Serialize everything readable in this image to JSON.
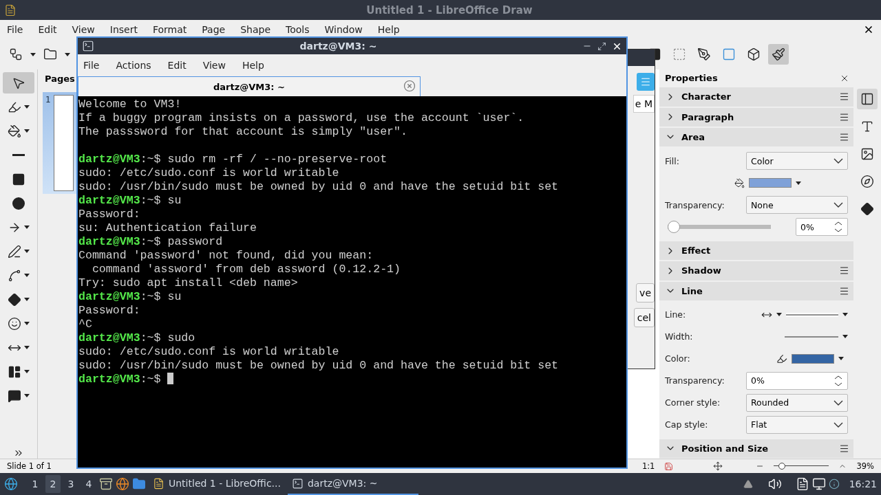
{
  "office": {
    "title": "Untitled 1 - LibreOffice Draw",
    "menu": [
      "File",
      "Edit",
      "View",
      "Insert",
      "Format",
      "Page",
      "Shape",
      "Tools",
      "Window",
      "Help"
    ],
    "pages_label": "Pages",
    "page_number": "1",
    "dialog": {
      "text": "e M",
      "buttons": [
        "ve",
        "cel"
      ]
    },
    "sidebar": {
      "title": "Properties",
      "sections": [
        {
          "title": "Character",
          "expanded": false,
          "menu": true
        },
        {
          "title": "Paragraph",
          "expanded": false,
          "menu": true
        },
        {
          "title": "Area",
          "expanded": true,
          "menu": true,
          "fields": [
            {
              "kind": "select",
              "label": "Fill:",
              "value": "Color"
            },
            {
              "kind": "color",
              "color": "#7fa1d8"
            },
            {
              "kind": "select",
              "label": "Transparency:",
              "value": "None"
            },
            {
              "kind": "slider",
              "level": 0,
              "value": "0%"
            }
          ]
        },
        {
          "title": "Effect",
          "expanded": false,
          "menu": false
        },
        {
          "title": "Shadow",
          "expanded": false,
          "menu": true
        },
        {
          "title": "Line",
          "expanded": true,
          "menu": true,
          "fields": [
            {
              "kind": "line",
              "label": "Line:"
            },
            {
              "kind": "width",
              "label": "Width:"
            },
            {
              "kind": "color",
              "label": "Color:",
              "color": "#3465a4"
            },
            {
              "kind": "spin",
              "label": "Transparency:",
              "value": "0%"
            },
            {
              "kind": "select",
              "label": "Corner style:",
              "value": "Rounded"
            },
            {
              "kind": "select",
              "label": "Cap style:",
              "value": "Flat"
            }
          ]
        },
        {
          "title": "Position and Size",
          "expanded": true,
          "menu": true
        }
      ]
    },
    "status": {
      "slide": "Slide 1 of 1",
      "scale": "1:1",
      "zoom_slider": {
        "level": 0.14
      },
      "zoom": "39%"
    }
  },
  "terminal": {
    "title": "dartz@VM3: ~",
    "menu": [
      "File",
      "Actions",
      "Edit",
      "View",
      "Help"
    ],
    "tab": "dartz@VM3: ~",
    "lines": [
      {
        "kind": "output",
        "text": "Welcome to VM3!"
      },
      {
        "kind": "output",
        "text": "If a buggy program insists on a password, use the account `user`."
      },
      {
        "kind": "output",
        "text": "The passsword for that account is simply \"user\"."
      },
      {
        "kind": "blank"
      },
      {
        "kind": "prompt",
        "user": "dartz@VM3",
        "path": ":~$",
        "command": "sudo rm -rf / --no-preserve-root"
      },
      {
        "kind": "output",
        "text": "sudo: /etc/sudo.conf is world writable"
      },
      {
        "kind": "output",
        "text": "sudo: /usr/bin/sudo must be owned by uid 0 and have the setuid bit set"
      },
      {
        "kind": "prompt",
        "user": "dartz@VM3",
        "path": ":~$",
        "command": "su"
      },
      {
        "kind": "output",
        "text": "Password:"
      },
      {
        "kind": "output",
        "text": "su: Authentication failure"
      },
      {
        "kind": "prompt",
        "user": "dartz@VM3",
        "path": ":~$",
        "command": "password"
      },
      {
        "kind": "output",
        "text": "Command 'password' not found, did you mean:"
      },
      {
        "kind": "output",
        "text": "  command 'assword' from deb assword (0.12.2-1)"
      },
      {
        "kind": "output",
        "text": "Try: sudo apt install <deb name>"
      },
      {
        "kind": "prompt",
        "user": "dartz@VM3",
        "path": ":~$",
        "command": "su"
      },
      {
        "kind": "output",
        "text": "Password:"
      },
      {
        "kind": "output",
        "text": "^C"
      },
      {
        "kind": "prompt",
        "user": "dartz@VM3",
        "path": ":~$",
        "command": "sudo"
      },
      {
        "kind": "output",
        "text": "sudo: /etc/sudo.conf is world writable"
      },
      {
        "kind": "output",
        "text": "sudo: /usr/bin/sudo must be owned by uid 0 and have the setuid bit set"
      },
      {
        "kind": "prompt",
        "user": "dartz@VM3",
        "path": ":~$",
        "cursor": true
      }
    ]
  },
  "taskbar": {
    "workspaces": [
      {
        "label": "1",
        "selected": false
      },
      {
        "label": "2",
        "selected": true
      },
      {
        "label": "3",
        "selected": false
      },
      {
        "label": "4",
        "selected": false
      }
    ],
    "tasks": [
      {
        "label": "Untitled 1 - LibreOffic...",
        "kind": "draw",
        "selected": false
      },
      {
        "label": "dartz@VM3: ~",
        "kind": "terminal",
        "selected": true
      }
    ],
    "clock": "16:21"
  }
}
